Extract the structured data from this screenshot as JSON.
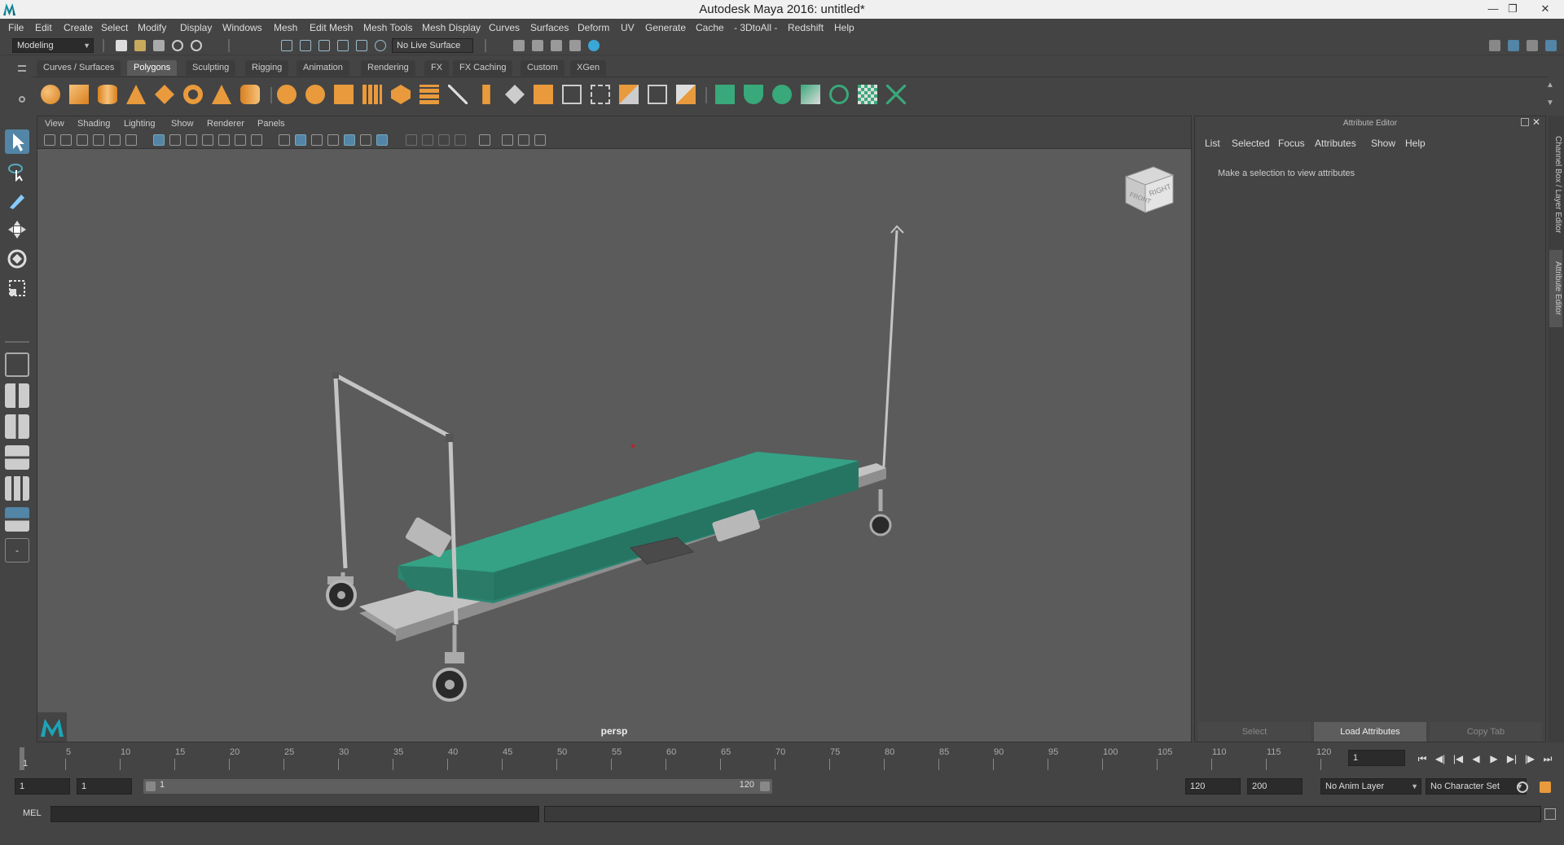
{
  "window": {
    "title": "Autodesk Maya 2016: untitled*"
  },
  "menu": [
    "File",
    "Edit",
    "Create",
    "Select",
    "Modify",
    "Display",
    "Windows",
    "Mesh",
    "Edit Mesh",
    "Mesh Tools",
    "Mesh Display",
    "Curves",
    "Surfaces",
    "Deform",
    "UV",
    "Generate",
    "Cache",
    "- 3DtoAll -",
    "Redshift",
    "Help"
  ],
  "status": {
    "mode": "Modeling",
    "live_surface": "No Live Surface"
  },
  "shelf": {
    "tabs": [
      "Curves / Surfaces",
      "Polygons",
      "Sculpting",
      "Rigging",
      "Animation",
      "Rendering",
      "FX",
      "FX Caching",
      "Custom",
      "XGen"
    ],
    "active_tab": "Polygons"
  },
  "viewport": {
    "menu": [
      "View",
      "Shading",
      "Lighting",
      "Show",
      "Renderer",
      "Panels"
    ],
    "camera": "persp",
    "viewcube": {
      "front": "FRONT",
      "right": "RIGHT"
    }
  },
  "attribute_editor": {
    "title": "Attribute Editor",
    "menu": [
      "List",
      "Selected",
      "Focus",
      "Attributes",
      "Show",
      "Help"
    ],
    "message": "Make a selection to view attributes",
    "buttons": {
      "select": "Select",
      "load": "Load Attributes",
      "copy": "Copy Tab"
    }
  },
  "side_tabs": {
    "channel_box": "Channel Box / Layer Editor",
    "attribute_editor": "Attribute Editor"
  },
  "timeline": {
    "labels": [
      "5",
      "10",
      "15",
      "20",
      "25",
      "30",
      "35",
      "40",
      "45",
      "50",
      "55",
      "60",
      "65",
      "70",
      "75",
      "80",
      "85",
      "90",
      "95",
      "100",
      "105",
      "110",
      "115",
      "120"
    ],
    "current_frame_marker": "1",
    "current_frame": "1"
  },
  "range": {
    "start": "1",
    "playback_start": "1",
    "slider_start": "1",
    "slider_end": "120",
    "playback_end": "120",
    "end": "200",
    "anim_layer": "No Anim Layer",
    "character_set": "No Character Set"
  },
  "command": {
    "language": "MEL"
  },
  "colors": {
    "mattress": "#2f8f78",
    "frame": "#b5b5b5",
    "accent": "#5285a6"
  }
}
